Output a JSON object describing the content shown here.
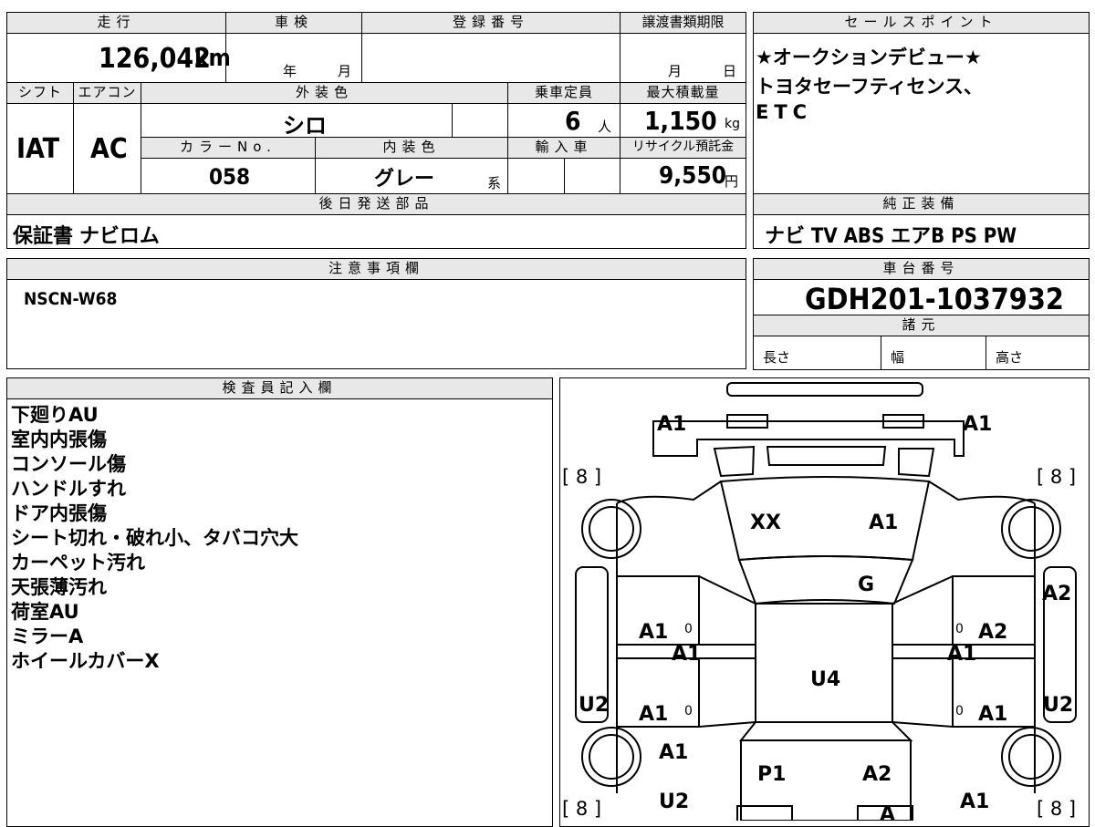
{
  "top": {
    "mileage_label": "走行",
    "mileage": "126,042",
    "mileage_unit": "km",
    "shaken_label": "車検",
    "shaken_year": "年",
    "shaken_month": "月",
    "reg_label": "登録番号",
    "deadline_label": "譲渡書類期限",
    "deadline_month": "月",
    "deadline_day": "日",
    "shift_label": "シフト",
    "shift": "IAT",
    "ac_label": "エアコン",
    "ac": "AC",
    "exterior_label": "外装色",
    "exterior": "シロ",
    "capacity_label": "乗車定員",
    "capacity": "6",
    "capacity_unit": "人",
    "load_label": "最大積載量",
    "load": "1,150",
    "load_unit": "kg",
    "color_no_label": "カラーNo.",
    "color_no": "058",
    "interior_label": "内装色",
    "interior": "グレー",
    "interior_suffix": "系",
    "import_label": "輸入車",
    "recycle_label": "リサイクル預託金",
    "recycle": "9,550",
    "recycle_unit": "円",
    "later_label": "後日発送部品",
    "later_value": "保証書 ナビロム"
  },
  "sales": {
    "label": "セールスポイント",
    "lines": [
      "★オークションデビュー★",
      "トヨタセーフティセンス、",
      "ETC"
    ]
  },
  "equipment": {
    "label": "純正装備",
    "value": "ナビ TV ABS エアB PS PW"
  },
  "caution": {
    "label": "注意事項欄",
    "value": "NSCN-W68"
  },
  "chassis": {
    "label": "車台番号",
    "value": "GDH201-1037932",
    "spec_label": "諸元",
    "length": "長さ",
    "width": "幅",
    "height": "高さ"
  },
  "inspector": {
    "label": "検査員記入欄",
    "lines": [
      "下廻りAU",
      "室内内張傷",
      "コンソール傷",
      "ハンドルすれ",
      "ドア内張傷",
      "シート切れ・破れ小、タバコ穴大",
      "カーペット汚れ",
      "天張薄汚れ",
      "荷室AU",
      "ミラーA",
      "ホイールカバーX"
    ]
  },
  "diagram": {
    "front_left": "A1",
    "front_right": "A1",
    "tire_fl": "[ 8 ]",
    "tire_fr": "[ 8 ]",
    "tire_rl": "[ 8 ]",
    "tire_rr": "[ 8 ]",
    "windshield_left": "XX",
    "windshield_right": "A1",
    "cowl": "G",
    "fender_right": "A2",
    "door_fl": "A1",
    "door_fr": "A2",
    "pillar_l": "A1",
    "pillar_r": "A1",
    "roof": "U4",
    "door_rl": "A1",
    "door_rr": "A1",
    "side_l": "U2",
    "side_r": "U2",
    "quarter_l": "A1",
    "rear_left": "P1",
    "rear_right": "A2",
    "bottom_l": "U2",
    "bottom_r": "A1",
    "rear_bumper": "A",
    "mark": "0"
  }
}
